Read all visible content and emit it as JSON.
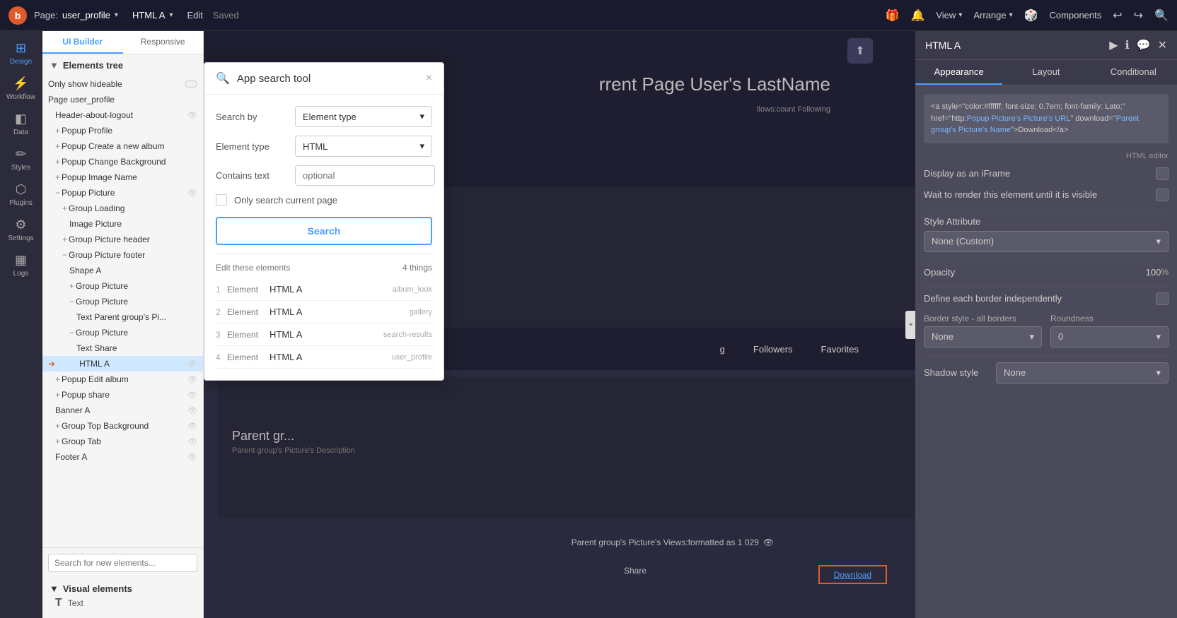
{
  "topbar": {
    "logo": "b",
    "page_label": "Page:",
    "page_name": "user_profile",
    "html_name": "HTML A",
    "edit_label": "Edit",
    "saved_label": "Saved",
    "view_label": "View",
    "arrange_label": "Arrange",
    "components_label": "Components"
  },
  "sidebar": {
    "items": [
      {
        "id": "design",
        "label": "Design",
        "icon": "⊞"
      },
      {
        "id": "workflow",
        "label": "Workflow",
        "icon": "⚡"
      },
      {
        "id": "data",
        "label": "Data",
        "icon": "◧"
      },
      {
        "id": "styles",
        "label": "Styles",
        "icon": "✏"
      },
      {
        "id": "plugins",
        "label": "Plugins",
        "icon": "⬡"
      },
      {
        "id": "settings",
        "label": "Settings",
        "icon": "⚙"
      },
      {
        "id": "logs",
        "label": "Logs",
        "icon": "▦"
      }
    ]
  },
  "elements_panel": {
    "tabs": [
      "UI Builder",
      "Responsive"
    ],
    "active_tab": "UI Builder",
    "title": "Elements tree",
    "items": [
      {
        "text": "Only show hideable",
        "depth": 0,
        "prefix": "",
        "has_eye": false
      },
      {
        "text": "Page user_profile",
        "depth": 0,
        "prefix": "",
        "has_eye": false
      },
      {
        "text": "Header-about-logout",
        "depth": 1,
        "prefix": "",
        "has_eye": true
      },
      {
        "text": "Popup Profile",
        "depth": 1,
        "prefix": "+",
        "has_eye": false
      },
      {
        "text": "Popup Create a new album",
        "depth": 1,
        "prefix": "+",
        "has_eye": false
      },
      {
        "text": "Popup Change Background",
        "depth": 1,
        "prefix": "+",
        "has_eye": false
      },
      {
        "text": "Popup Image Name",
        "depth": 1,
        "prefix": "+",
        "has_eye": false
      },
      {
        "text": "Popup Picture",
        "depth": 1,
        "prefix": "−",
        "has_eye": true
      },
      {
        "text": "Group Loading",
        "depth": 2,
        "prefix": "+",
        "has_eye": false
      },
      {
        "text": "Image Picture",
        "depth": 3,
        "prefix": "",
        "has_eye": false
      },
      {
        "text": "Group Picture header",
        "depth": 2,
        "prefix": "+",
        "has_eye": false
      },
      {
        "text": "Group Picture footer",
        "depth": 2,
        "prefix": "−",
        "has_eye": false
      },
      {
        "text": "Shape A",
        "depth": 3,
        "prefix": "",
        "has_eye": false
      },
      {
        "text": "Group Picture",
        "depth": 3,
        "prefix": "+",
        "has_eye": false
      },
      {
        "text": "Group Picture",
        "depth": 3,
        "prefix": "−",
        "has_eye": false
      },
      {
        "text": "Text Parent group's Pi...",
        "depth": 4,
        "prefix": "",
        "has_eye": false
      },
      {
        "text": "Group Picture",
        "depth": 3,
        "prefix": "−",
        "has_eye": false
      },
      {
        "text": "Text Share",
        "depth": 4,
        "prefix": "",
        "has_eye": false
      },
      {
        "text": "HTML A",
        "depth": 4,
        "prefix": "",
        "has_eye": true,
        "selected": true,
        "highlighted": true
      }
    ],
    "below_items": [
      {
        "text": "Popup Edit album",
        "depth": 1,
        "prefix": "+",
        "has_eye": true
      },
      {
        "text": "Popup share",
        "depth": 1,
        "prefix": "+",
        "has_eye": true
      },
      {
        "text": "Banner A",
        "depth": 1,
        "prefix": "",
        "has_eye": true
      },
      {
        "text": "Group Top Background",
        "depth": 1,
        "prefix": "+",
        "has_eye": true
      },
      {
        "text": "Group Tab",
        "depth": 1,
        "prefix": "+",
        "has_eye": true
      },
      {
        "text": "Footer A",
        "depth": 1,
        "prefix": "",
        "has_eye": true
      }
    ],
    "search_placeholder": "Search for new elements...",
    "visual_elements_title": "Visual elements",
    "text_element": "Text"
  },
  "search_popup": {
    "title": "App search tool",
    "close_icon": "×",
    "search_by_label": "Search by",
    "search_by_value": "Element type",
    "element_type_label": "Element type",
    "element_type_value": "HTML",
    "contains_text_label": "Contains text",
    "contains_text_placeholder": "optional",
    "only_current_page_label": "Only search current page",
    "search_button": "Search",
    "results_label": "Edit these elements",
    "results_count": "4 things",
    "results": [
      {
        "num": "1",
        "label": "Element",
        "type": "HTML A",
        "context": "album_look"
      },
      {
        "num": "2",
        "label": "Element",
        "type": "HTML A",
        "context": "gallery"
      },
      {
        "num": "3",
        "label": "Element",
        "type": "HTML A",
        "context": "search-results"
      },
      {
        "num": "4",
        "label": "Element",
        "type": "HTML A",
        "context": "user_profile"
      }
    ]
  },
  "right_panel": {
    "title": "HTML A",
    "tabs": [
      "Appearance",
      "Layout",
      "Conditional"
    ],
    "active_tab": "Appearance",
    "html_content": "<a style=\"color:#ffffff; font-size: 0.7em; font-family: Lato;\" href=\"http:Popup Picture's Picture's URL\" download=\"Parent group's Picture's Name\">Download</a>",
    "html_editor_label": "HTML editor",
    "display_iframe_label": "Display as an iFrame",
    "wait_render_label": "Wait to render this element until it is visible",
    "style_attribute_label": "Style Attribute",
    "style_attribute_value": "None (Custom)",
    "opacity_label": "Opacity",
    "opacity_value": "100",
    "opacity_unit": "%",
    "define_border_label": "Define each border independently",
    "border_style_label": "Border style - all borders",
    "border_style_value": "None",
    "roundness_label": "Roundness",
    "roundness_value": "0",
    "shadow_style_label": "Shadow style",
    "shadow_style_value": "None"
  },
  "canvas": {
    "lastname": "rrent Page User's LastName",
    "following_text": "llows:count Following",
    "tabs": [
      "g",
      "Followers",
      "Favorites"
    ],
    "group_title": "Parent gr...",
    "group_desc": "Parent group's Picture's Description",
    "views_text": "Parent group's Picture's Views:formatted as 1 029",
    "share_label": "Share",
    "download_label": "Download"
  }
}
